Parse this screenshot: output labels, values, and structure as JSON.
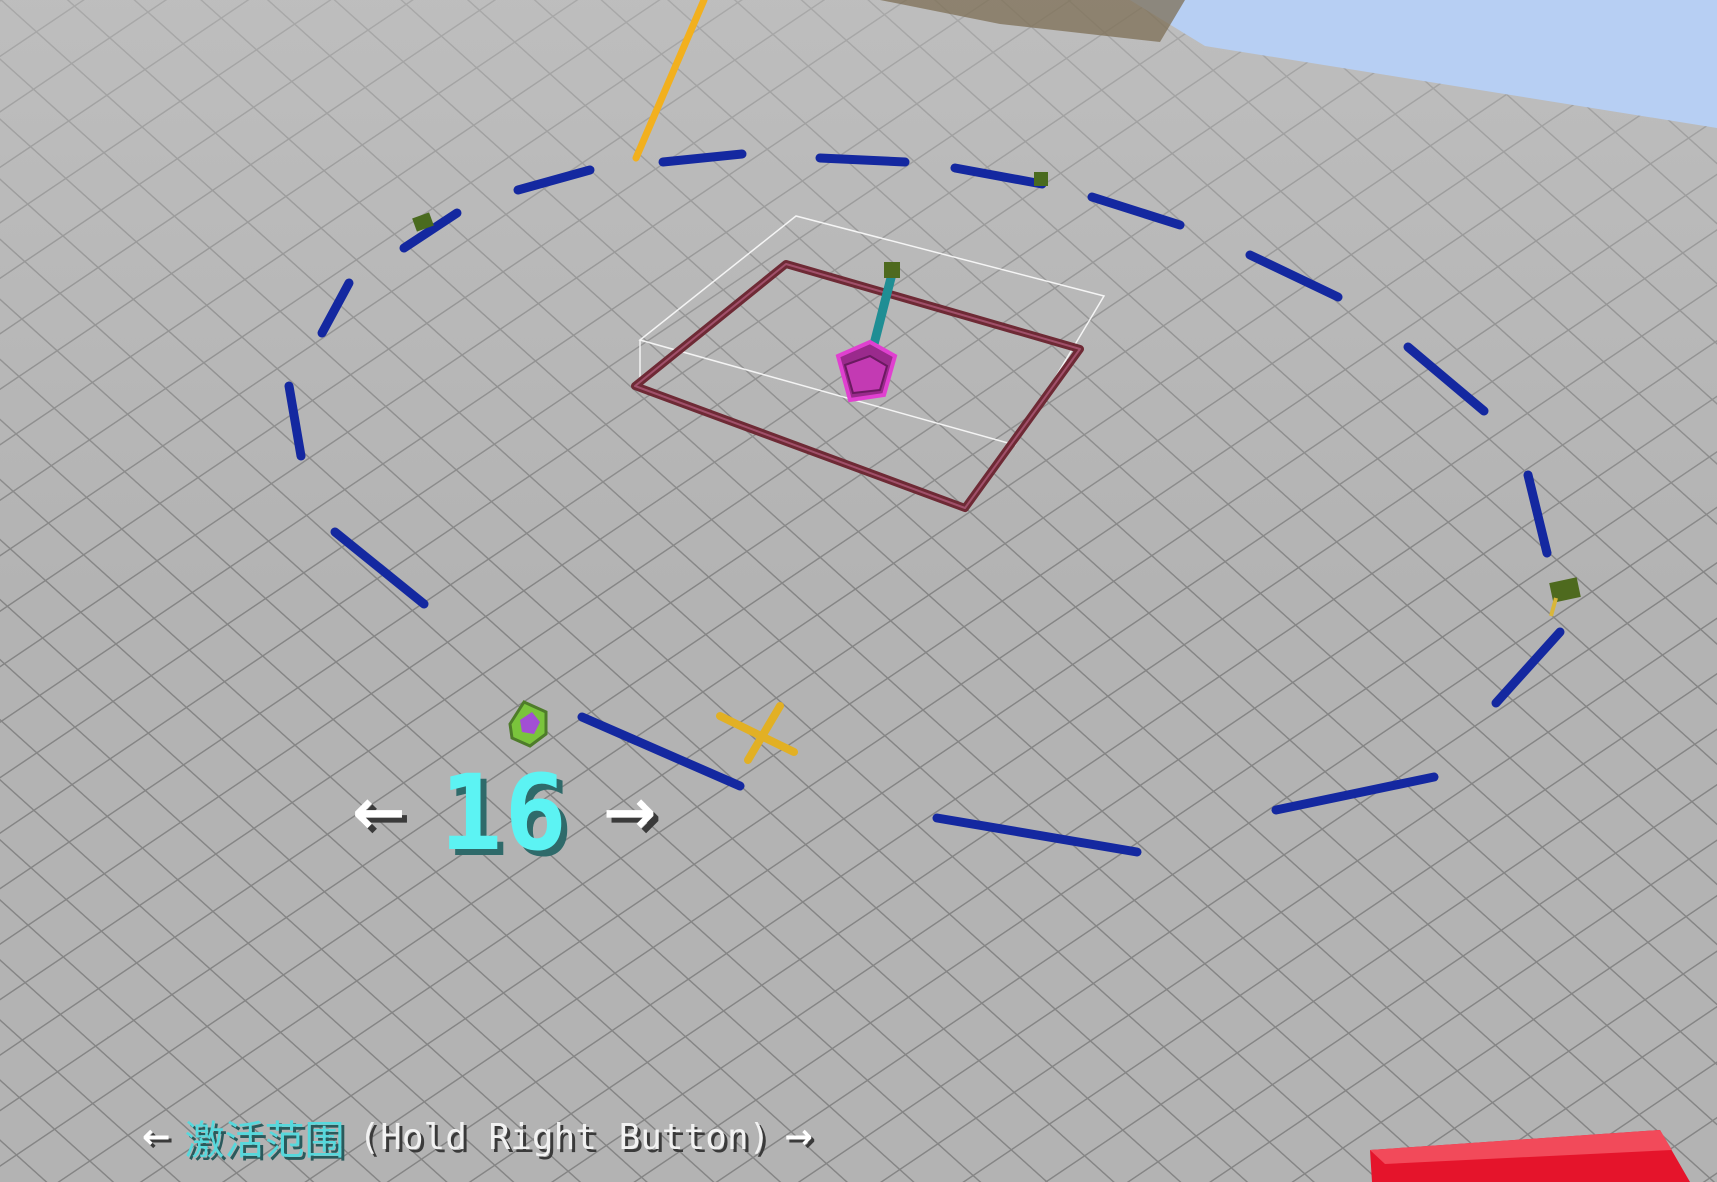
{
  "hud": {
    "range_value": "16",
    "left_arrow": "←",
    "right_arrow": "→",
    "mode_label": "激活范围",
    "hint": "(Hold Right Button)",
    "hint_left_arrow": "←",
    "hint_right_arrow": "→"
  },
  "colors": {
    "sky": "#b7cff3",
    "ground": "#b3b3b3",
    "grid_line": "#8a8a8a",
    "range_ring": "#1428a0",
    "frame": "#6e2a35",
    "machine_block": "#d12fc0",
    "pole": "#f2b01e",
    "red_block": "#e5142b",
    "value_text": "#5cf3f3",
    "label_text": "#57d8dc"
  },
  "icons": {
    "machine": "magenta-machine-block-icon",
    "item": "green-gem-item-icon",
    "cursor": "crosshair-icon",
    "pole": "yellow-pole-icon",
    "markers": "green-marker-icon",
    "held_block": "red-block-icon"
  }
}
